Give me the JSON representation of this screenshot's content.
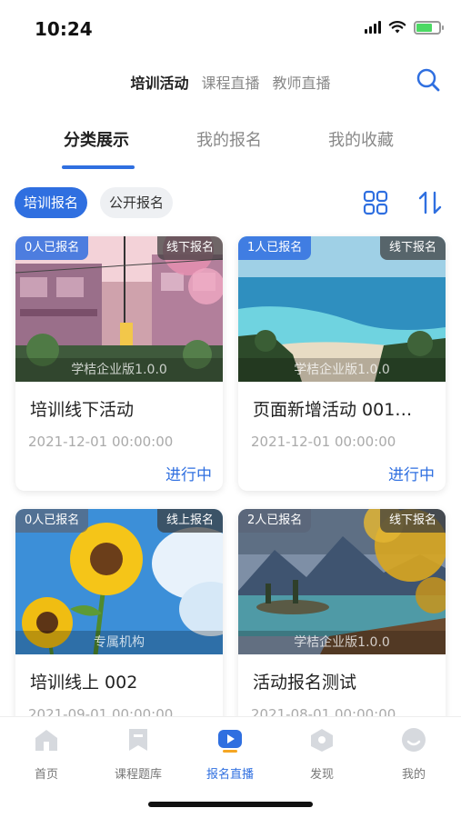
{
  "status_bar": {
    "time": "10:24",
    "battery_level": 0.7
  },
  "top_tabs": [
    {
      "label": "培训活动",
      "active": true
    },
    {
      "label": "课程直播",
      "active": false
    },
    {
      "label": "教师直播",
      "active": false
    }
  ],
  "sub_tabs": [
    {
      "label": "分类展示",
      "active": true
    },
    {
      "label": "我的报名",
      "active": false
    },
    {
      "label": "我的收藏",
      "active": false
    }
  ],
  "filters": [
    {
      "label": "培训报名",
      "active": true
    },
    {
      "label": "公开报名",
      "active": false
    }
  ],
  "cards": [
    {
      "signups": "0人已报名",
      "mode": "线下报名",
      "watermark": "学桔企业版1.0.0",
      "title": "培训线下活动",
      "date": "2021-12-01 00:00:00",
      "status": "进行中"
    },
    {
      "signups": "1人已报名",
      "mode": "线下报名",
      "watermark": "学桔企业版1.0.0",
      "title": "页面新增活动 001…",
      "date": "2021-12-01 00:00:00",
      "status": "进行中"
    },
    {
      "signups": "0人已报名",
      "mode": "线上报名",
      "watermark": "专属机构",
      "title": "培训线上 002",
      "date": "2021-09-01 00:00:00",
      "status": ""
    },
    {
      "signups": "2人已报名",
      "mode": "线下报名",
      "watermark": "学桔企业版1.0.0",
      "title": "活动报名测试",
      "date": "2021-08-01 00:00:00",
      "status": ""
    }
  ],
  "bottom_nav": [
    {
      "label": "首页",
      "icon": "home-icon",
      "active": false
    },
    {
      "label": "课程题库",
      "icon": "question-bank-icon",
      "active": false
    },
    {
      "label": "报名直播",
      "icon": "live-icon",
      "active": true
    },
    {
      "label": "发现",
      "icon": "discover-icon",
      "active": false
    },
    {
      "label": "我的",
      "icon": "profile-icon",
      "active": false
    }
  ],
  "colors": {
    "accent": "#2f6fe0",
    "inactive_text": "#888888",
    "nav_icon": "#d6d9de"
  }
}
